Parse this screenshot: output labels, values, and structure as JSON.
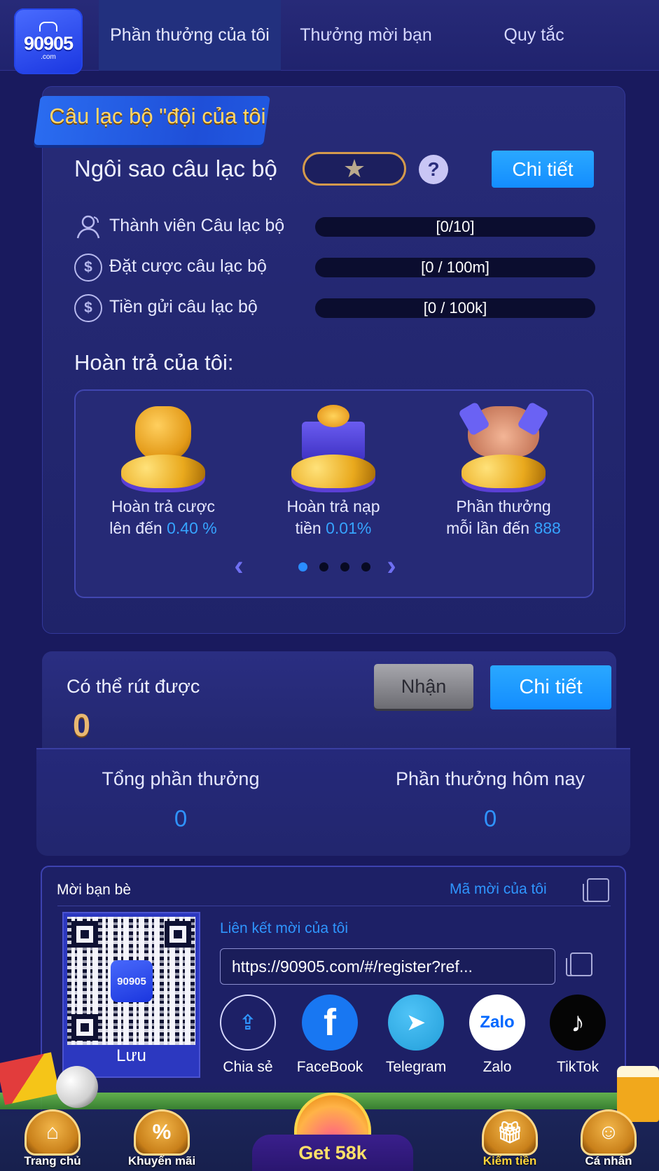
{
  "header": {
    "logo_text": "90905",
    "logo_sub": ".com",
    "tabs": [
      {
        "label": "Phần thưởng của tôi",
        "active": true
      },
      {
        "label": "Thưởng mời bạn",
        "active": false
      },
      {
        "label": "Quy tắc",
        "active": false
      }
    ]
  },
  "club": {
    "ribbon_title": "Câu lạc bộ \"đội của tôi",
    "star_label": "Ngôi sao câu lạc bộ",
    "star_icon": "star-icon",
    "help_icon": "question-icon",
    "detail_label": "Chi tiết",
    "stats": [
      {
        "label": "Thành viên Câu lạc bộ",
        "value": "[0/10]",
        "icon": "person-icon"
      },
      {
        "label": "Đặt cược câu lạc bộ",
        "value": "[0 / 100m]",
        "icon": "coin-icon"
      },
      {
        "label": "Tiền gửi câu lạc bộ",
        "value": "[0 / 100k]",
        "icon": "coin-icon"
      }
    ]
  },
  "rebate": {
    "title": "Hoàn trả của tôi:",
    "items": [
      {
        "line1": "Hoàn trả cược",
        "line2_prefix": "lên đến",
        "highlight": "0.40 %"
      },
      {
        "line1": "Hoàn trả nạp",
        "line2_prefix": "tiền",
        "highlight": "0.01%"
      },
      {
        "line1": "Phần thưởng",
        "line2_prefix": "mỗi lần đến",
        "highlight": "888"
      }
    ],
    "page_count": 4,
    "active_page": 1
  },
  "withdraw": {
    "label": "Có thể rút được",
    "value": "0",
    "receive_label": "Nhận",
    "detail_label": "Chi tiết"
  },
  "totals": {
    "total_label": "Tổng phần thưởng",
    "total_value": "0",
    "today_label": "Phần thưởng hôm nay",
    "today_value": "0"
  },
  "invite": {
    "title": "Mời bạn bè",
    "code_label": "Mã mời của tôi",
    "link_label": "Liên kết mời của tôi",
    "link_value": "https://90905.com/#/register?ref...",
    "qr_logo": "90905",
    "save_label": "Lưu",
    "share": [
      {
        "label": "Chia sẻ",
        "icon": "share-icon"
      },
      {
        "label": "FaceBook",
        "icon": "facebook-icon"
      },
      {
        "label": "Telegram",
        "icon": "telegram-icon"
      },
      {
        "label": "Zalo",
        "icon": "zalo-icon"
      },
      {
        "label": "TikTok",
        "icon": "tiktok-icon"
      }
    ]
  },
  "bottom_nav": {
    "items": [
      {
        "label": "Trang chủ",
        "icon": "home-icon"
      },
      {
        "label": "Khuyến mãi",
        "icon": "promo-icon"
      },
      {
        "label": "Kiếm tiền",
        "icon": "gift-icon",
        "active": true
      },
      {
        "label": "Cá nhân",
        "icon": "profile-icon"
      }
    ],
    "get_label": "Get 58k"
  },
  "colors": {
    "background": "#191a5e",
    "accent_blue": "#138dff",
    "highlight_blue": "#36a4ff",
    "gold": "#ffd66b"
  }
}
